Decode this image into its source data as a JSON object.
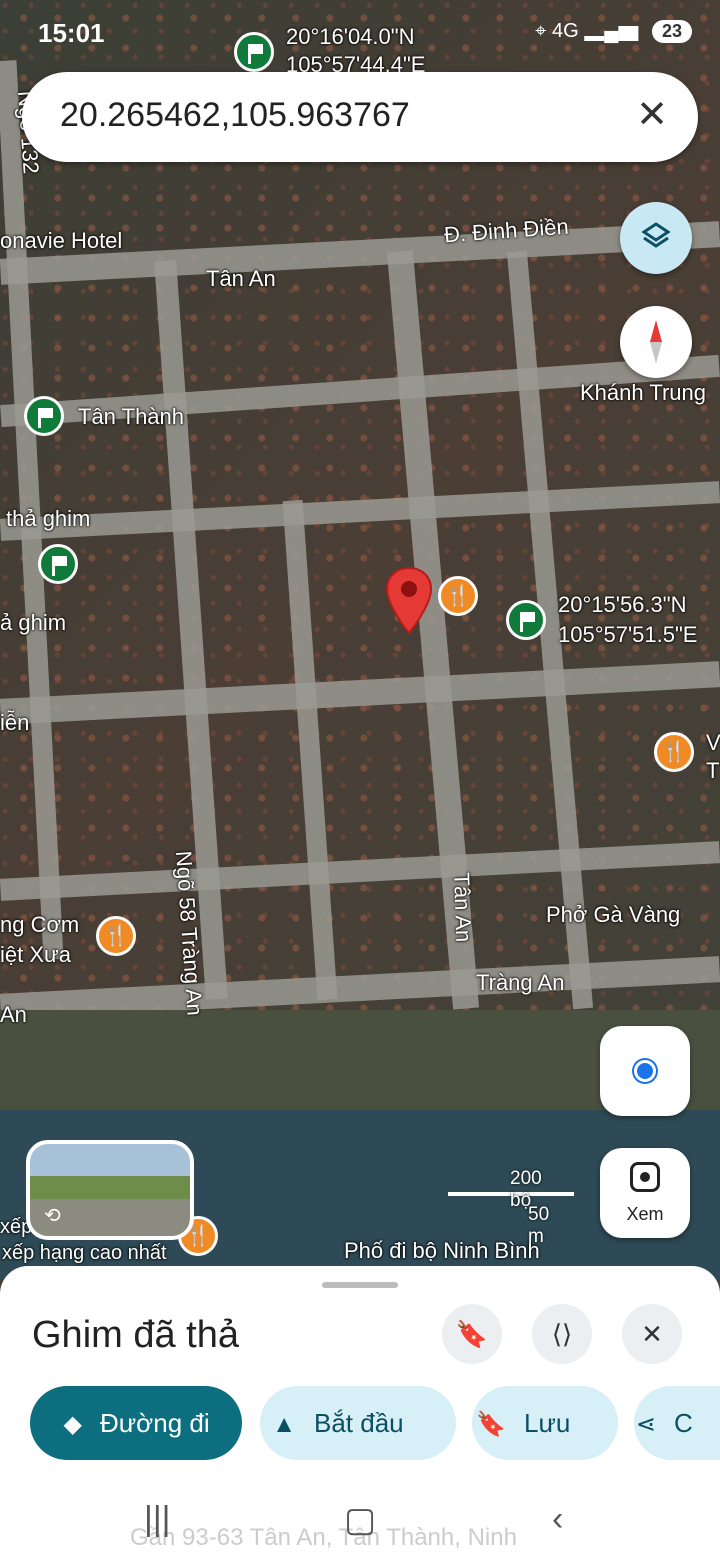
{
  "status_bar": {
    "time": "15:01",
    "network": "4G",
    "battery": "23"
  },
  "search": {
    "value": "20.265462,105.963767"
  },
  "map_labels": {
    "coord_top_lat": "20°16'04.0\"N",
    "coord_top_lng": "105°57'44.4\"E",
    "coord_right_lat": "20°15'56.3\"N",
    "coord_right_lng": "105°57'51.5\"E",
    "hotel": "onavie Hotel",
    "dinh_dien": "Đ. Đinh Điền",
    "tan_an_top": "Tân An",
    "tan_thanh": "Tân Thành",
    "khanh_trung": "Khánh Trung",
    "tha_ghim": "thả ghim",
    "a_ghim": "ả ghim",
    "ien": "iễn",
    "ngo58": "Ngõ 58 Tràng An",
    "tan_an_vertical": "Tân An",
    "ng_com": "ng Cơm",
    "viet_xua": "iệt Xưa",
    "an": "An",
    "pho_ga_vang": "Phở Gà Vàng",
    "trang_an": "Tràng An",
    "v": "V",
    "t": "T",
    "ngo132": "Ngõ 132",
    "xep": "xếp",
    "xep_hang": "xếp hạng cao nhất",
    "pho_di_bo": "Phố đi bộ Ninh Bình"
  },
  "scale": {
    "feet": "200 bộ",
    "meters": "50 m"
  },
  "lens": {
    "label": "Xem"
  },
  "sheet": {
    "title": "Ghim đã thả",
    "chips": [
      "Đường đi",
      "Bắt đầu",
      "Lưu",
      "C"
    ],
    "address": "Gần 93-63 Tân An, Tân Thành, Ninh"
  }
}
